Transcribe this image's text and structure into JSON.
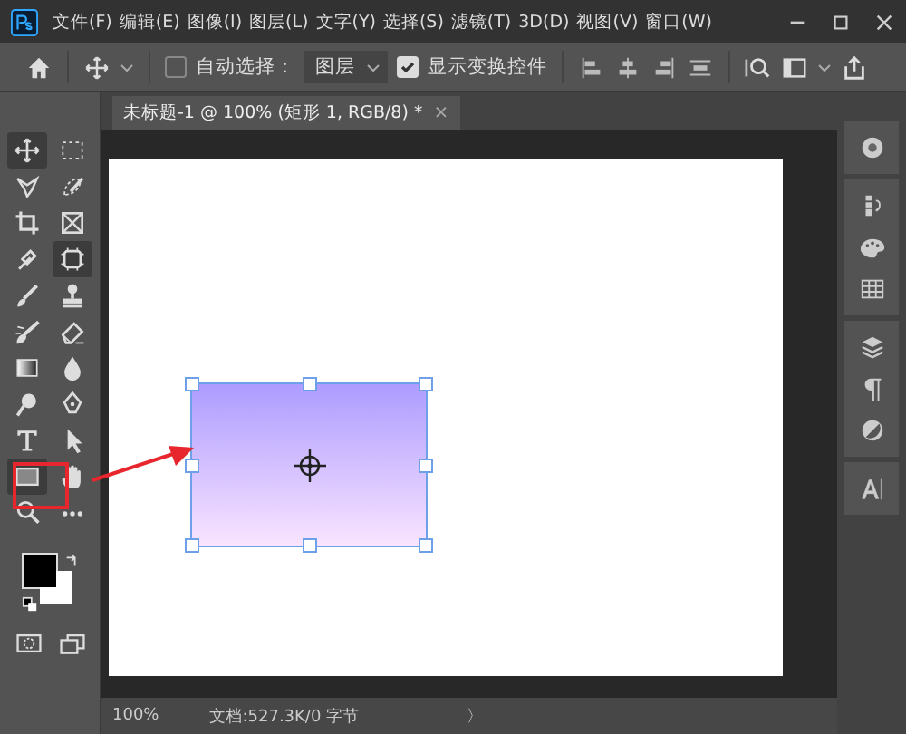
{
  "menu": [
    "文件(F)",
    "编辑(E)",
    "图像(I)",
    "图层(L)",
    "文字(Y)",
    "选择(S)",
    "滤镜(T)",
    "3D(D)",
    "视图(V)",
    "窗口(W)"
  ],
  "options_bar": {
    "auto_select": {
      "label": "自动选择：",
      "checked": false
    },
    "target": {
      "value": "图层"
    },
    "show_transform": {
      "label": "显示变换控件",
      "checked": true
    }
  },
  "document_tab": {
    "title": "未标题-1 @ 100% (矩形 1, RGB/8) *",
    "close": "×",
    "selected": true
  },
  "tools": [
    {
      "kind": "move",
      "selected": true
    },
    {
      "kind": "marquee",
      "selected": false
    },
    {
      "kind": "lasso",
      "selected": false
    },
    {
      "kind": "quick-select",
      "selected": false
    },
    {
      "kind": "crop",
      "selected": false
    },
    {
      "kind": "frame",
      "selected": false
    },
    {
      "kind": "eyedropper",
      "selected": false
    },
    {
      "kind": "patch",
      "selected": true
    },
    {
      "kind": "brush",
      "selected": false
    },
    {
      "kind": "stamp",
      "selected": false
    },
    {
      "kind": "history-brush",
      "selected": false
    },
    {
      "kind": "eraser",
      "selected": false
    },
    {
      "kind": "gradient",
      "selected": false
    },
    {
      "kind": "drop",
      "selected": false
    },
    {
      "kind": "dodge",
      "selected": false
    },
    {
      "kind": "pen",
      "selected": false
    },
    {
      "kind": "type",
      "selected": false
    },
    {
      "kind": "pointer",
      "selected": false
    },
    {
      "kind": "rectangle",
      "selected": true
    },
    {
      "kind": "hand",
      "selected": false
    },
    {
      "kind": "zoom",
      "selected": false
    },
    {
      "kind": "more",
      "selected": false
    }
  ],
  "status_bar": {
    "zoom": "100%",
    "document": "文档:527.3K/0 字节",
    "arrow": "〉"
  }
}
